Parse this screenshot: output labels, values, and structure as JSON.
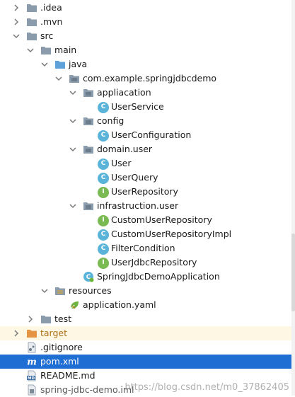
{
  "tree": {
    "items": [
      {
        "label": ".idea",
        "icon": "folder-icon",
        "arrow": "chevron-right-icon"
      },
      {
        "label": ".mvn",
        "icon": "folder-icon",
        "arrow": "chevron-right-icon"
      },
      {
        "label": "src",
        "icon": "folder-icon",
        "arrow": "chevron-down-icon"
      },
      {
        "label": "main",
        "icon": "folder-icon",
        "arrow": "chevron-down-icon"
      },
      {
        "label": "java",
        "icon": "source-folder-icon",
        "arrow": "chevron-down-icon"
      },
      {
        "label": "com.example.springjdbcdemo",
        "icon": "package-icon",
        "arrow": "chevron-down-icon"
      },
      {
        "label": "appliacation",
        "icon": "package-icon",
        "arrow": "chevron-down-icon"
      },
      {
        "label": "UserService",
        "icon": "class-icon"
      },
      {
        "label": "config",
        "icon": "package-icon",
        "arrow": "chevron-down-icon"
      },
      {
        "label": "UserConfiguration",
        "icon": "class-icon"
      },
      {
        "label": "domain.user",
        "icon": "package-icon",
        "arrow": "chevron-down-icon"
      },
      {
        "label": "User",
        "icon": "class-icon"
      },
      {
        "label": "UserQuery",
        "icon": "class-icon"
      },
      {
        "label": "UserRepository",
        "icon": "interface-icon"
      },
      {
        "label": "infrastruction.user",
        "icon": "package-icon",
        "arrow": "chevron-down-icon"
      },
      {
        "label": "CustomUserRepository",
        "icon": "interface-icon"
      },
      {
        "label": "CustomUserRepositoryImpl",
        "icon": "class-icon"
      },
      {
        "label": "FilterCondition",
        "icon": "class-icon"
      },
      {
        "label": "UserJdbcRepository",
        "icon": "interface-icon"
      },
      {
        "label": "SpringJdbcDemoApplication",
        "icon": "spring-boot-class-icon"
      },
      {
        "label": "resources",
        "icon": "resources-folder-icon",
        "arrow": "chevron-down-icon"
      },
      {
        "label": "application.yaml",
        "icon": "spring-yaml-icon"
      },
      {
        "label": "test",
        "icon": "folder-icon",
        "arrow": "chevron-right-icon"
      },
      {
        "label": "target",
        "icon": "excluded-folder-icon",
        "arrow": "chevron-right-icon"
      },
      {
        "label": ".gitignore",
        "icon": "gitignore-icon"
      },
      {
        "label": "pom.xml",
        "icon": "maven-icon"
      },
      {
        "label": "README.md",
        "icon": "markdown-icon"
      },
      {
        "label": "spring-jdbc-demo.iml",
        "icon": "module-file-icon"
      }
    ],
    "class_badge": "C",
    "interface_badge": "I"
  },
  "watermark": "https://blog.csdn.net/m0_37862405",
  "colors": {
    "selection": "#1f6ed4",
    "folder": "#8a9bab",
    "source_folder": "#5ea2d9",
    "excluded_folder": "#e59443",
    "class": "#5ab4d9",
    "interface": "#7aba52"
  }
}
